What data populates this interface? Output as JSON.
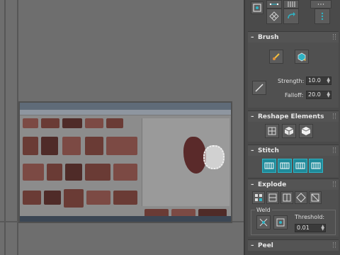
{
  "brush": {
    "title": "Brush",
    "strength_label": "Strength:",
    "strength_value": "10.0",
    "falloff_label": "Falloff:",
    "falloff_value": "20.0"
  },
  "reshape": {
    "title": "Reshape Elements"
  },
  "stitch": {
    "title": "Stitch"
  },
  "explode": {
    "title": "Explode",
    "weld_label": "Weld",
    "threshold_label": "Threshold:",
    "threshold_value": "0.01"
  },
  "peel": {
    "title": "Peel"
  },
  "colors": {
    "accent_teal": "#1f8a9a",
    "panel_bg": "#4a4a4a",
    "viewport_bg": "#6e6e6e"
  },
  "icons": [
    "selection-mode-icon",
    "brush-paint-icon",
    "brush-select-icon",
    "line-tool-icon",
    "grid-icon",
    "cube-icon",
    "cube-alt-icon",
    "stitch-icon",
    "explode-icon",
    "weld-icon",
    "minus-icon"
  ]
}
